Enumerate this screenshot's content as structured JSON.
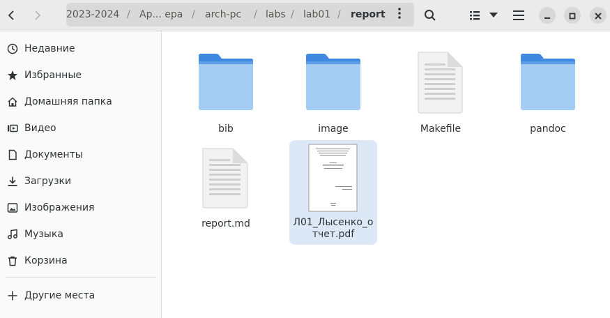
{
  "header": {
    "breadcrumb": [
      {
        "label": "2023-2024"
      },
      {
        "label": "Ар... ера"
      },
      {
        "label": "arch-pc"
      },
      {
        "label": "labs"
      },
      {
        "label": "lab01"
      },
      {
        "label": "report"
      }
    ],
    "separator": "/",
    "icons": {
      "back": "chevron-left-icon",
      "forward": "chevron-right-icon",
      "path_menu": "vertical-dots-icon",
      "search": "search-icon",
      "view": "list-view-icon",
      "view_options": "chevron-down-icon",
      "main_menu": "hamburger-icon",
      "minimize": "minimize-icon",
      "maximize": "maximize-icon",
      "close": "close-icon"
    }
  },
  "sidebar": {
    "items": [
      {
        "label": "Недавние",
        "icon": "clock-icon"
      },
      {
        "label": "Избранные",
        "icon": "star-icon"
      },
      {
        "label": "Домашняя папка",
        "icon": "home-icon"
      },
      {
        "label": "Видео",
        "icon": "video-icon"
      },
      {
        "label": "Документы",
        "icon": "document-icon"
      },
      {
        "label": "Загрузки",
        "icon": "download-icon"
      },
      {
        "label": "Изображения",
        "icon": "image-icon"
      },
      {
        "label": "Музыка",
        "icon": "music-icon"
      },
      {
        "label": "Корзина",
        "icon": "trash-icon"
      }
    ],
    "other_places": {
      "label": "Другие места",
      "icon": "plus-icon"
    }
  },
  "files": [
    {
      "name": "bib",
      "type": "folder"
    },
    {
      "name": "image",
      "type": "folder"
    },
    {
      "name": "Makefile",
      "type": "text"
    },
    {
      "name": "pandoc",
      "type": "folder"
    },
    {
      "name": "report.md",
      "type": "text"
    },
    {
      "name": "Л01_Лысенко_отчет.pdf",
      "type": "pdf",
      "selected": true
    }
  ],
  "colors": {
    "folder_top": "#3f8ae0",
    "folder_body": "#a5cdf3",
    "selection": "#dde8f6",
    "header_bg": "#ebebeb",
    "sidebar_bg": "#fafafa"
  }
}
